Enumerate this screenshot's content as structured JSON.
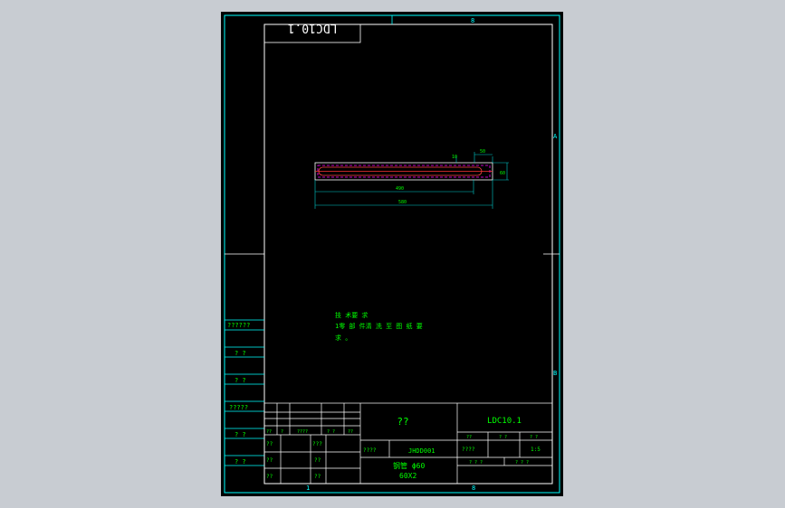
{
  "sheet": {
    "top_ref_center": "1",
    "top_ref_mid": "8",
    "bottom_ref_left": "1",
    "bottom_ref_mid": "8",
    "side_ref_a": "A",
    "side_ref_b": "B"
  },
  "title_mirror": "LDC10.1",
  "drawing": {
    "dim_top_small": "10",
    "dim_top_right": "50",
    "dim_height": "60",
    "dim_inner_length": "490",
    "dim_total_length": "580"
  },
  "tech_notes": [
    "技 术要 求",
    "1零 部 件清 洗 至 图 纸 要",
    "求 。"
  ],
  "left_column": [
    "??????",
    "? ?",
    "? ?",
    "?????",
    "? ?",
    "? ?"
  ],
  "title_block": {
    "change_header": [
      "??",
      "?",
      "????",
      "? ?",
      "??"
    ],
    "row_labels_left": [
      "??",
      "??",
      "??"
    ],
    "row_labels_mid": [
      "???",
      "??",
      "??"
    ],
    "name": "??",
    "code": "LDC10.1",
    "material_label": "????",
    "material_value": "JHDD001",
    "part_name": "钢管 ϕ60",
    "spec": "60X2",
    "scale_header": [
      "??",
      "? ?",
      "? ?"
    ],
    "weight_label": "????",
    "scale_value": "1:5",
    "sheet_info": [
      "? ? ?",
      "? ? ?"
    ]
  },
  "colors": {
    "border": "#00ffff",
    "frame": "#ffffff",
    "text_green": "#00ff00",
    "dimension": "#00cccc",
    "hatch": "#ff00ff",
    "centerline": "#ff3333"
  }
}
